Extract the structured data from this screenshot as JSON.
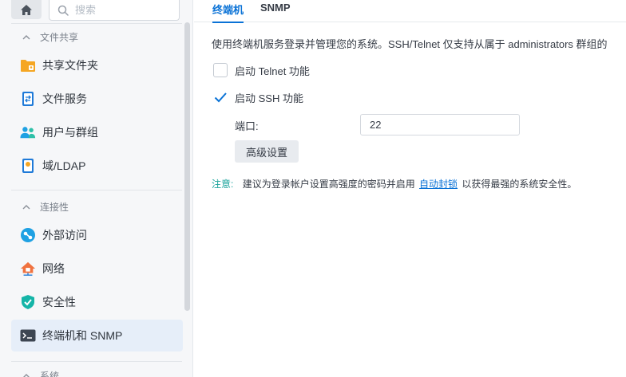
{
  "sidebar": {
    "search_placeholder": "搜索",
    "sections": [
      {
        "title": "文件共享"
      },
      {
        "title": "连接性"
      },
      {
        "title": "系统"
      }
    ],
    "items": [
      {
        "label": "共享文件夹",
        "icon": "folder-icon"
      },
      {
        "label": "文件服务",
        "icon": "file-services-icon"
      },
      {
        "label": "用户与群组",
        "icon": "users-icon"
      },
      {
        "label": "域/LDAP",
        "icon": "domain-icon"
      },
      {
        "label": "外部访问",
        "icon": "external-access-icon"
      },
      {
        "label": "网络",
        "icon": "network-icon"
      },
      {
        "label": "安全性",
        "icon": "shield-icon"
      },
      {
        "label": "终端机和 SNMP",
        "icon": "terminal-icon"
      }
    ]
  },
  "tabs": [
    {
      "label": "终端机",
      "active": true
    },
    {
      "label": "SNMP",
      "active": false
    }
  ],
  "main": {
    "description": "使用终端机服务登录并管理您的系统。SSH/Telnet 仅支持从属于 administrators 群组的",
    "telnet_label": "启动 Telnet 功能",
    "telnet_checked": false,
    "ssh_label": "启动 SSH 功能",
    "ssh_checked": true,
    "port_label": "端口:",
    "port_value": "22",
    "advanced_button": "高级设置",
    "note_label": "注意:",
    "note_text_before": "建议为登录帐户设置高强度的密码并启用",
    "note_link": "自动封锁",
    "note_text_after": "以获得最强的系统安全性。"
  },
  "colors": {
    "accent": "#0a72d6",
    "note": "#1aa39b",
    "active_item_bg": "#e6eef9"
  }
}
